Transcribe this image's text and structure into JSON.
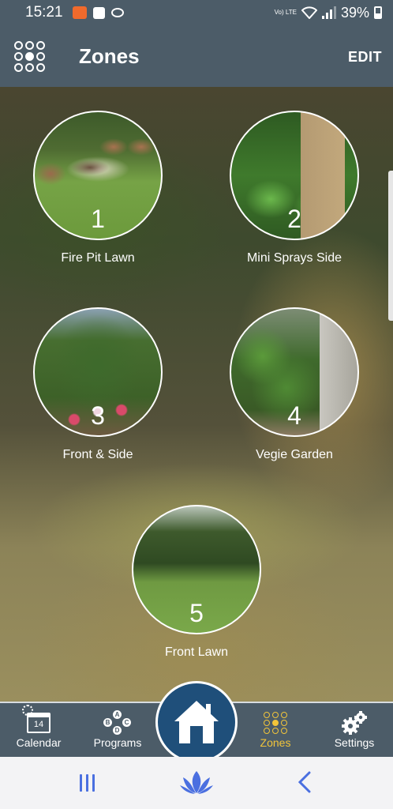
{
  "status_bar": {
    "time": "15:21",
    "volte": "Vo) LTE",
    "battery": "39%"
  },
  "header": {
    "title": "Zones",
    "edit_label": "EDIT"
  },
  "zones": [
    {
      "number": "1",
      "name": "Fire Pit Lawn"
    },
    {
      "number": "2",
      "name": "Mini Sprays Side"
    },
    {
      "number": "3",
      "name": "Front & Side"
    },
    {
      "number": "4",
      "name": "Vegie Garden"
    },
    {
      "number": "5",
      "name": "Front Lawn"
    }
  ],
  "tabs": {
    "calendar": {
      "label": "Calendar",
      "icon": "calendar-icon",
      "day": "14"
    },
    "programs": {
      "label": "Programs",
      "icon": "programs-icon",
      "badges": [
        "A",
        "B",
        "C",
        "D"
      ]
    },
    "home": {
      "icon": "home-icon"
    },
    "zones": {
      "label": "Zones",
      "icon": "zones-grid-icon",
      "active": true
    },
    "settings": {
      "label": "Settings",
      "icon": "gears-icon"
    }
  },
  "colors": {
    "header_bg": "#4c5c68",
    "active_tab": "#f2c53a",
    "home_button": "#1f4f7a",
    "system_nav_icon": "#4a6fe0"
  }
}
